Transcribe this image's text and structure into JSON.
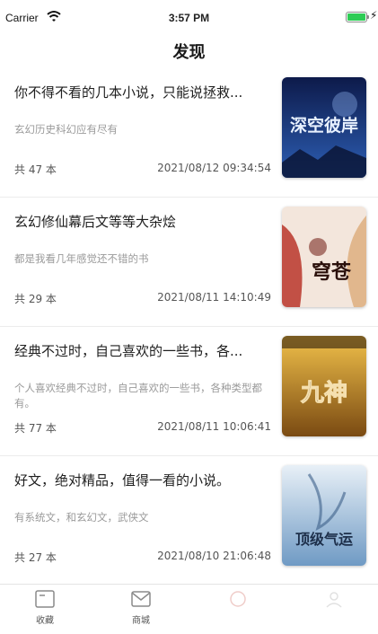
{
  "status_bar": {
    "carrier": "Carrier",
    "time": "3:57 PM",
    "battery_color": "#2ecc55"
  },
  "nav": {
    "title": "发现"
  },
  "cards": [
    {
      "title": "你不得不看的几本小说，只能说拯救...",
      "desc": "玄幻历史科幻应有尽有",
      "count": "共 47 本",
      "date": "2021/08/12 09:34:54",
      "cover_text": "深空彼岸",
      "cover_colors": [
        "#0d1a4a",
        "#2d5fb5"
      ]
    },
    {
      "title": "玄幻修仙幕后文等等大杂烩",
      "desc": "都是我看几年感觉还不错的书",
      "count": "共 29 本",
      "date": "2021/08/11 14:10:49",
      "cover_text": "穹苍",
      "cover_colors": [
        "#f3e6dc",
        "#b8352a"
      ]
    },
    {
      "title": "经典不过时，自己喜欢的一些书，各...",
      "desc": "个人喜欢经典不过时，自己喜欢的一些书，各种类型都有。",
      "count": "共 77 本",
      "date": "2021/08/11 10:06:41",
      "cover_text": "九神",
      "cover_colors": [
        "#f0c04a",
        "#7a4a12"
      ]
    },
    {
      "title": "好文，绝对精品，值得一看的小说。",
      "desc": "有系统文，和玄幻文，武侠文",
      "count": "共 27 本",
      "date": "2021/08/10 21:06:48",
      "cover_text": "顶级气运",
      "cover_colors": [
        "#e8f0f7",
        "#6f9ac4"
      ]
    }
  ],
  "tab_bar": {
    "tabs": [
      {
        "label": "收藏",
        "icon": "bookmark-box-icon"
      },
      {
        "label": "商城",
        "icon": "mail-shop-icon"
      },
      {
        "label": "",
        "icon": "discover-icon"
      },
      {
        "label": "",
        "icon": "profile-icon"
      }
    ]
  }
}
